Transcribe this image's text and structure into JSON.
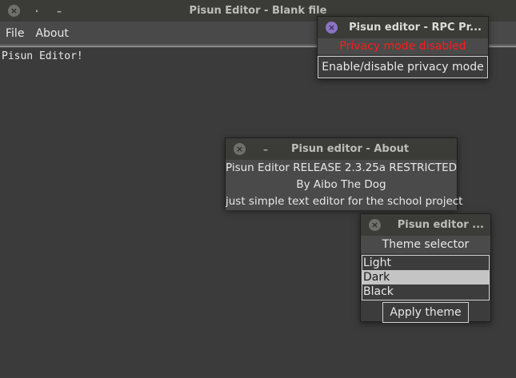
{
  "main_window": {
    "title": "Pisun Editor - Blank file",
    "close_glyph": "×",
    "minimize_glyph": "–",
    "extra_glyph": "·",
    "menu": [
      {
        "label": "File"
      },
      {
        "label": "About"
      }
    ],
    "editor_text": "Pisun Editor!"
  },
  "rpc_window": {
    "title": "Pisun editor - RPC Pr...",
    "status": "Privacy mode disabled",
    "toggle_label": "Enable/disable privacy mode"
  },
  "about_window": {
    "title": "Pisun editor - About",
    "lines": [
      "Pisun Editor RELEASE 2.3.25a RESTRICTED",
      "By Aibo The Dog",
      "just simple text editor for the school project"
    ]
  },
  "theme_window": {
    "title": "Pisun editor ...",
    "label": "Theme selector",
    "options": [
      "Light",
      "Dark",
      "Black"
    ],
    "selected": "Dark",
    "apply_label": "Apply theme"
  },
  "colors": {
    "status_red": "#ff1a1a",
    "active_close": "#8b73c4"
  }
}
